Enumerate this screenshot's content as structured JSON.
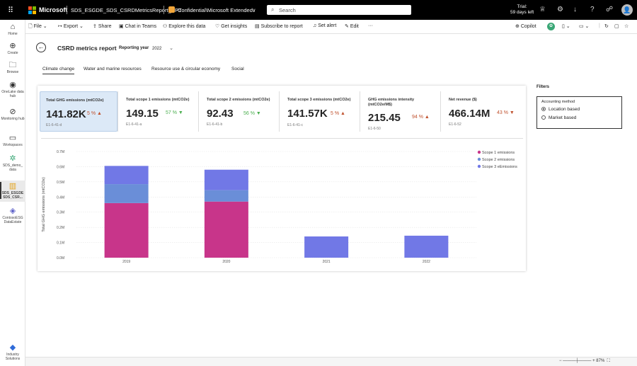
{
  "topbar": {
    "brand": "Microsoft",
    "report_path": "SDS_ESGDE_SDS_CSRDMetricsReport_RPT",
    "sensitivity": "Confidential\\Microsoft Extended",
    "sensitivity_chevron": "∨",
    "search_placeholder": "Search",
    "trial_line1": "Trial:",
    "trial_line2": "59 days left",
    "avatar_initial": "👤"
  },
  "leftnav": [
    {
      "label": "Home",
      "icon": "⌂"
    },
    {
      "label": "Create",
      "icon": "⊕"
    },
    {
      "label": "Browse",
      "icon": "🗀"
    },
    {
      "label": "OneLake data hub",
      "icon": "◉"
    },
    {
      "label": "Monitoring hub",
      "icon": "⊘"
    },
    {
      "label": "Workspaces",
      "icon": "▭"
    },
    {
      "label": "SDS_demo_ data",
      "icon": "✲"
    },
    {
      "label": "SDS_ESGDE SDS_CSR...",
      "icon": "▥"
    },
    {
      "label": "ContosoESG DataEstate",
      "icon": "◈"
    },
    {
      "label": "Industry Solutions",
      "icon": "◆"
    }
  ],
  "commandbar": {
    "file": "File",
    "export": "Export",
    "share": "Share",
    "chat_in_teams": "Chat in Teams",
    "explore": "Explore this data",
    "insights": "Get insights",
    "subscribe": "Subscribe to report",
    "set_alert": "Set alert",
    "edit": "Edit",
    "more": "···",
    "copilot": "Copilot"
  },
  "report": {
    "title": "CSRD metrics report",
    "year_label": "Reporting year",
    "year_value": "2022",
    "tabs": [
      "Climate change",
      "Water and marine resources",
      "Resource use & circular economy",
      "Social"
    ],
    "active_tab": 0
  },
  "kpis": [
    {
      "title": "Total GHG emissions (mtCO2e)",
      "value": "141.82K",
      "change": "5 % ▲",
      "trend": "up",
      "id": "E1-6-41-d"
    },
    {
      "title": "Total scope 1 emissions (mtCO2e)",
      "value": "149.15",
      "change": "57 % ▼",
      "trend": "down",
      "id": "E1-6-41-a"
    },
    {
      "title": "Total scope 2 emissions (mtCO2e)",
      "value": "92.43",
      "change": "56 % ▼",
      "trend": "down",
      "id": "E1-6-41-b"
    },
    {
      "title": "Total scope 3 emissions (mtCO2e)",
      "value": "141.57K",
      "change": "5 % ▲",
      "trend": "up",
      "id": "E1-6-41-c"
    },
    {
      "title": "GHG emissions intensity (mtCO2e/M$)",
      "value": "215.45",
      "change": "94 % ▲",
      "trend": "up",
      "id": "E1-6-50"
    },
    {
      "title": "Net revenue ($)",
      "value": "466.14M",
      "change": "43 % ▼",
      "trend": "up",
      "id": "E1-6-52"
    }
  ],
  "filters": {
    "title": "Filters",
    "group_title": "Accounting method",
    "options": [
      "Location based",
      "Market based"
    ],
    "selected": 0
  },
  "statusbar": {
    "zoom": "87%"
  },
  "chart_data": {
    "type": "bar",
    "stacked": true,
    "categories": [
      "2019",
      "2020",
      "2021",
      "2022"
    ],
    "series": [
      {
        "name": "Scope 1 emissions",
        "color": "#c8358a",
        "values": [
          360000,
          370000,
          0,
          0
        ]
      },
      {
        "name": "Scope 2 emissions",
        "color": "#6a8ed8",
        "values": [
          125000,
          75000,
          0,
          0
        ]
      },
      {
        "name": "Scope 3 eEmissions",
        "color": "#7178e6",
        "values": [
          120000,
          135000,
          140000,
          145000
        ]
      }
    ],
    "ylabel": "Total GHG emissions (mtCO2e)",
    "yticks": [
      "0.0M",
      "0.1M",
      "0.2M",
      "0.3M",
      "0.4M",
      "0.5M",
      "0.6M",
      "0.7M"
    ],
    "ylim": [
      0,
      700000
    ],
    "grid": true,
    "legend_position": "top-right"
  }
}
